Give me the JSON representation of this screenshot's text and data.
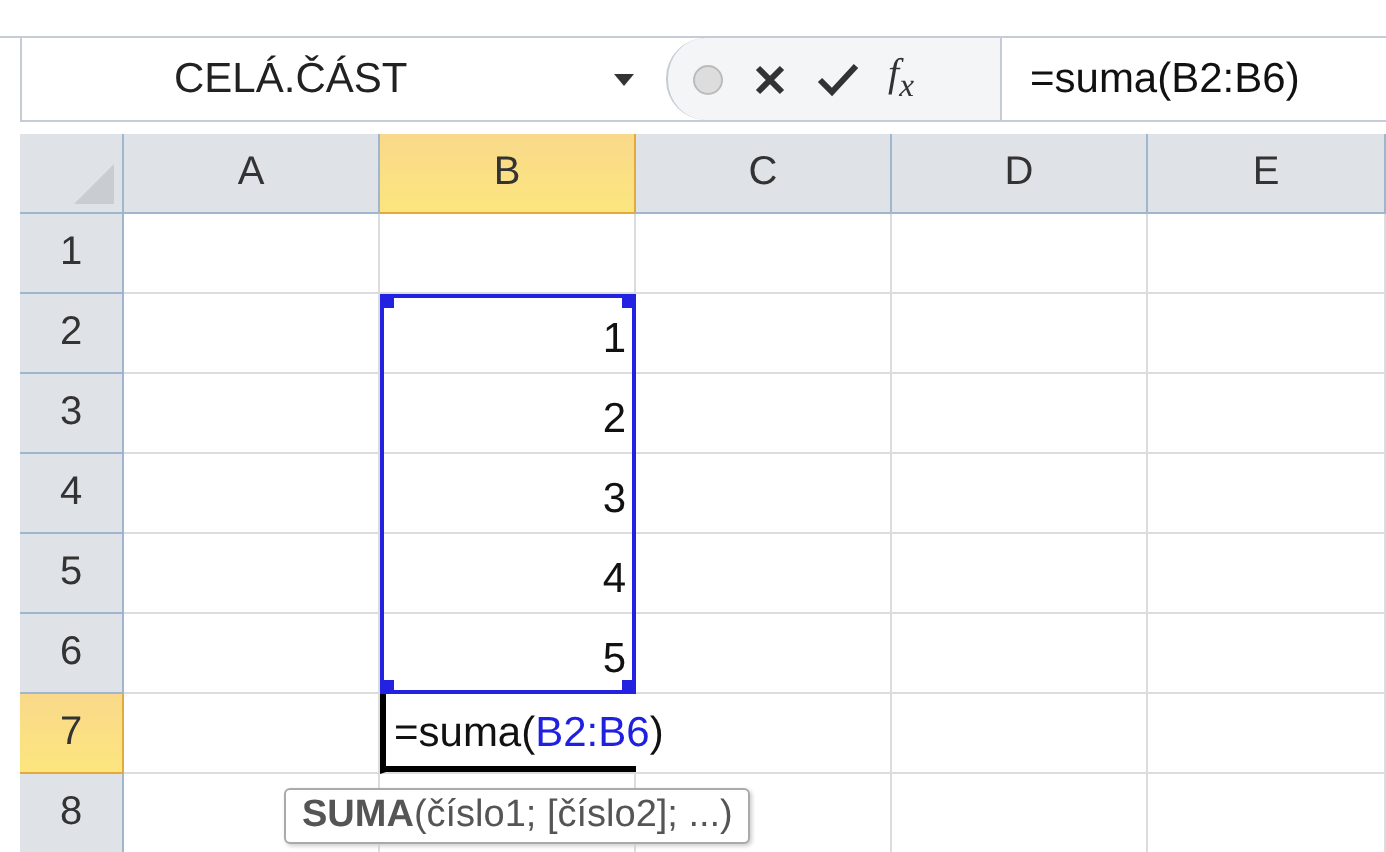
{
  "name_box": {
    "value": "CELÁ.ČÁST"
  },
  "formula_bar": {
    "function_label": "f$_{x}$",
    "value": "=suma(B2:B6)"
  },
  "columns": [
    {
      "label": "A",
      "selected": false
    },
    {
      "label": "B",
      "selected": true
    },
    {
      "label": "C",
      "selected": false
    },
    {
      "label": "D",
      "selected": false
    },
    {
      "label": "E",
      "selected": false
    }
  ],
  "rows": [
    {
      "label": "1",
      "selected": false,
      "cells": [
        "",
        "",
        "",
        "",
        ""
      ]
    },
    {
      "label": "2",
      "selected": false,
      "cells": [
        "",
        "1",
        "",
        "",
        ""
      ]
    },
    {
      "label": "3",
      "selected": false,
      "cells": [
        "",
        "2",
        "",
        "",
        ""
      ]
    },
    {
      "label": "4",
      "selected": false,
      "cells": [
        "",
        "3",
        "",
        "",
        ""
      ]
    },
    {
      "label": "5",
      "selected": false,
      "cells": [
        "",
        "4",
        "",
        "",
        ""
      ]
    },
    {
      "label": "6",
      "selected": false,
      "cells": [
        "",
        "5",
        "",
        "",
        ""
      ]
    },
    {
      "label": "7",
      "selected": true,
      "cells": [
        "",
        "",
        "",
        "",
        ""
      ]
    },
    {
      "label": "8",
      "selected": false,
      "cells": [
        "",
        "",
        "",
        "",
        ""
      ]
    }
  ],
  "cell_editor": {
    "prefix": "=suma(",
    "reference": "B2:B6",
    "suffix": ")"
  },
  "tooltip": {
    "text": "**SUMA**(číslo1; [číslo2]; ...)"
  }
}
